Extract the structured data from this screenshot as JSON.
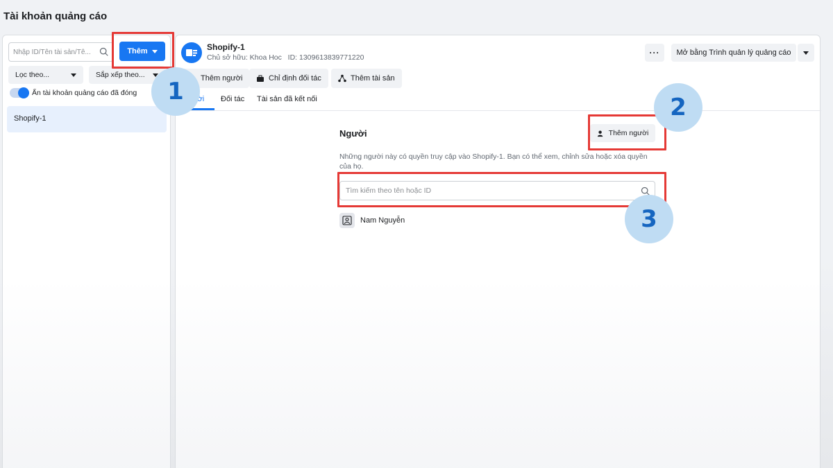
{
  "page": {
    "title": "Tài khoản quảng cáo"
  },
  "sidebar": {
    "search_placeholder": "Nhập ID/Tên tài sản/Tê...",
    "add_button": "Thêm",
    "filter_label": "Lọc theo...",
    "sort_label": "Sắp xếp theo...",
    "toggle_label": "Ẩn tài khoản quảng cáo đã đóng",
    "accounts": [
      {
        "name": "Shopify-1"
      }
    ]
  },
  "account": {
    "name": "Shopify-1",
    "owner_prefix": "Chủ sở hữu: Khoa Hoc",
    "id_label": "ID:",
    "id_value": "1309613839771220",
    "more_label": "···",
    "open_manager_label": "Mở bằng Trình quản lý quảng cáo"
  },
  "actions": {
    "add_people": "Thêm người",
    "assign_partner": "Chỉ định đối tác",
    "add_asset": "Thêm tài sản"
  },
  "tabs": [
    {
      "label": "gười",
      "active": true
    },
    {
      "label": "Đối tác",
      "active": false
    },
    {
      "label": "Tài sản đã kết nối",
      "active": false
    }
  ],
  "people_section": {
    "title": "Người",
    "add_button": "Thêm người",
    "description": "Những người này có quyền truy cập vào Shopify-1. Bạn có thể xem, chỉnh sửa hoặc xóa quyền của họ.",
    "search_placeholder": "Tìm kiếm theo tên hoặc ID",
    "people": [
      {
        "name": "Nam Nguyễn"
      }
    ]
  },
  "annotations": {
    "badge_1": "1",
    "badge_2": "2",
    "badge_3": "3"
  },
  "colors": {
    "accent": "#1877f2",
    "annotation_red": "#e53935",
    "badge_fill": "#bfdcf3",
    "badge_text": "#1565c0"
  }
}
